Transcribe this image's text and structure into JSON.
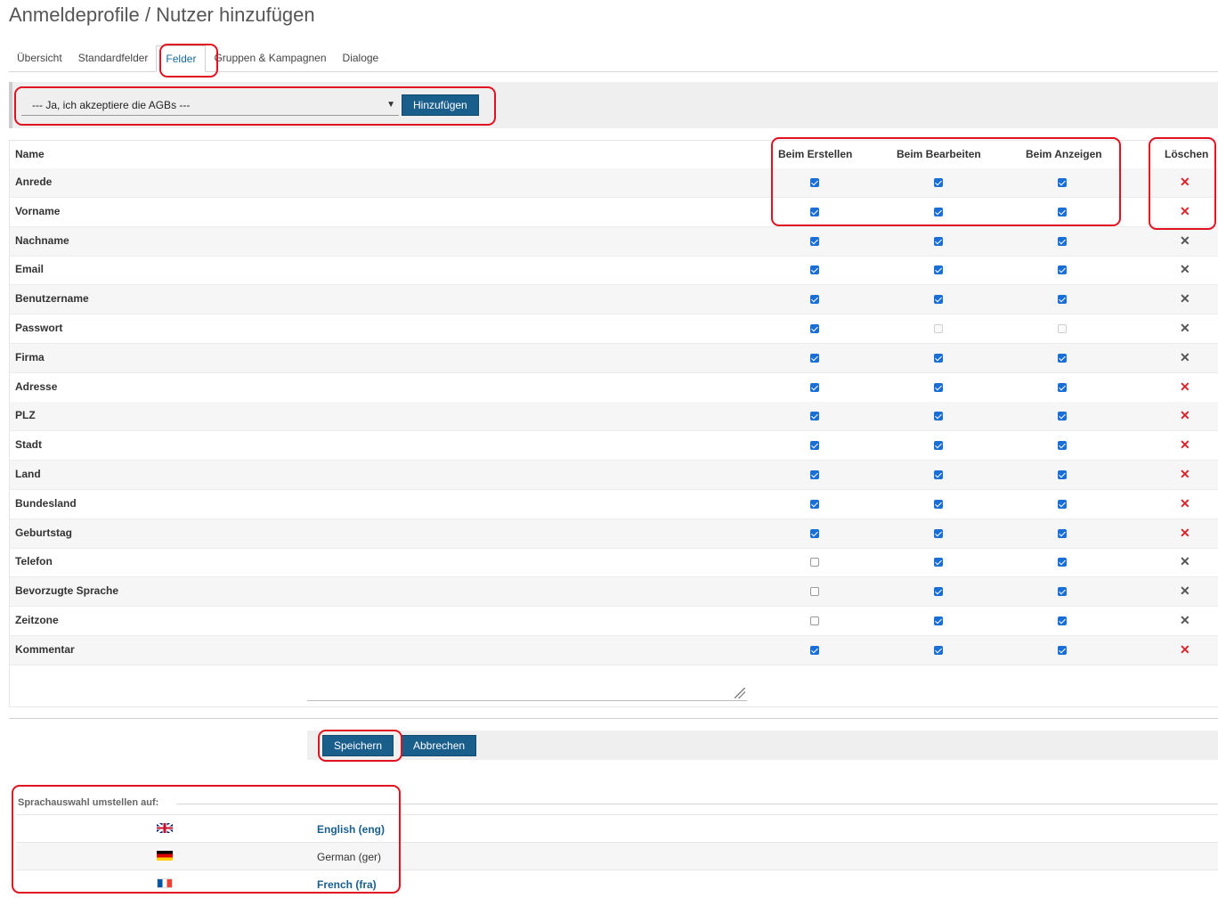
{
  "page": {
    "title": "Anmeldeprofile / Nutzer hinzufügen"
  },
  "tabs": [
    {
      "label": "Übersicht",
      "active": false
    },
    {
      "label": "Standardfelder",
      "active": false
    },
    {
      "label": "Felder",
      "active": true
    },
    {
      "label": "Gruppen & Kampagnen",
      "active": false
    },
    {
      "label": "Dialoge",
      "active": false
    }
  ],
  "add_field": {
    "selected": "--- Ja, ich akzeptiere die AGBs ---",
    "button": "Hinzufügen"
  },
  "fields_table": {
    "headers": {
      "name": "Name",
      "create": "Beim Erstellen",
      "edit": "Beim Bearbeiten",
      "show": "Beim Anzeigen",
      "delete": "Löschen"
    },
    "rows": [
      {
        "name": "Anrede",
        "create": "on",
        "edit": "on",
        "show": "on",
        "delete_color": "red"
      },
      {
        "name": "Vorname",
        "create": "on",
        "edit": "on",
        "show": "on",
        "delete_color": "red"
      },
      {
        "name": "Nachname",
        "create": "on",
        "edit": "on",
        "show": "on",
        "delete_color": "grey"
      },
      {
        "name": "Email",
        "create": "on",
        "edit": "on",
        "show": "on",
        "delete_color": "grey"
      },
      {
        "name": "Benutzername",
        "create": "on",
        "edit": "on",
        "show": "on",
        "delete_color": "grey"
      },
      {
        "name": "Passwort",
        "create": "on",
        "edit": "disabled",
        "show": "disabled",
        "delete_color": "grey"
      },
      {
        "name": "Firma",
        "create": "on",
        "edit": "on",
        "show": "on",
        "delete_color": "grey"
      },
      {
        "name": "Adresse",
        "create": "on",
        "edit": "on",
        "show": "on",
        "delete_color": "red"
      },
      {
        "name": "PLZ",
        "create": "on",
        "edit": "on",
        "show": "on",
        "delete_color": "red"
      },
      {
        "name": "Stadt",
        "create": "on",
        "edit": "on",
        "show": "on",
        "delete_color": "red"
      },
      {
        "name": "Land",
        "create": "on",
        "edit": "on",
        "show": "on",
        "delete_color": "red"
      },
      {
        "name": "Bundesland",
        "create": "on",
        "edit": "on",
        "show": "on",
        "delete_color": "red"
      },
      {
        "name": "Geburtstag",
        "create": "on",
        "edit": "on",
        "show": "on",
        "delete_color": "red"
      },
      {
        "name": "Telefon",
        "create": "off",
        "edit": "on",
        "show": "on",
        "delete_color": "grey"
      },
      {
        "name": "Bevorzugte Sprache",
        "create": "off",
        "edit": "on",
        "show": "on",
        "delete_color": "grey"
      },
      {
        "name": "Zeitzone",
        "create": "off",
        "edit": "on",
        "show": "on",
        "delete_color": "grey"
      },
      {
        "name": "Kommentar",
        "create": "on",
        "edit": "on",
        "show": "on",
        "delete_color": "red"
      }
    ]
  },
  "actions": {
    "save": "Speichern",
    "cancel": "Abbrechen"
  },
  "language": {
    "title": "Sprachauswahl umstellen auf:",
    "options": [
      {
        "flag": "uk-flag-icon",
        "label": "English (eng)",
        "link": true
      },
      {
        "flag": "de-flag-icon",
        "label": "German (ger)",
        "link": false
      },
      {
        "flag": "fr-flag-icon",
        "label": "French (fra)",
        "link": true
      }
    ]
  },
  "colors": {
    "accent": "#1a5e8c",
    "highlight": "#e0121f",
    "delete_red": "#d8232a"
  }
}
